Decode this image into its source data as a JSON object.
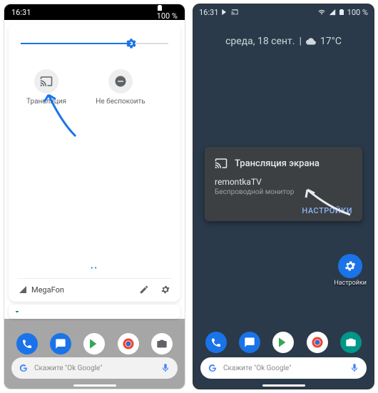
{
  "left": {
    "status": {
      "time": "16:31",
      "battery": "100 %"
    },
    "brightness_percent": 75,
    "quick_tiles": {
      "cast_label": "Трансляция",
      "dnd_label": "Не беспокоить"
    },
    "page_dots": "••",
    "carrier": "MegaFon",
    "search_hint": "Скажите \"Ok Google\""
  },
  "right": {
    "status": {
      "time": "16:31",
      "battery": "100 %"
    },
    "date": "среда, 18 сент.",
    "temp": "17°C",
    "cast_card": {
      "title": "Трансляция экрана",
      "device": "remontkaTV",
      "subtitle": "Беспроводной монитор",
      "settings": "НАСТРОЙКИ"
    },
    "settings_label": "Настройки",
    "search_hint": "Скажите \"Ok Google\""
  },
  "colors": {
    "accent": "#1a73e8",
    "dark_card": "#3c4043"
  }
}
